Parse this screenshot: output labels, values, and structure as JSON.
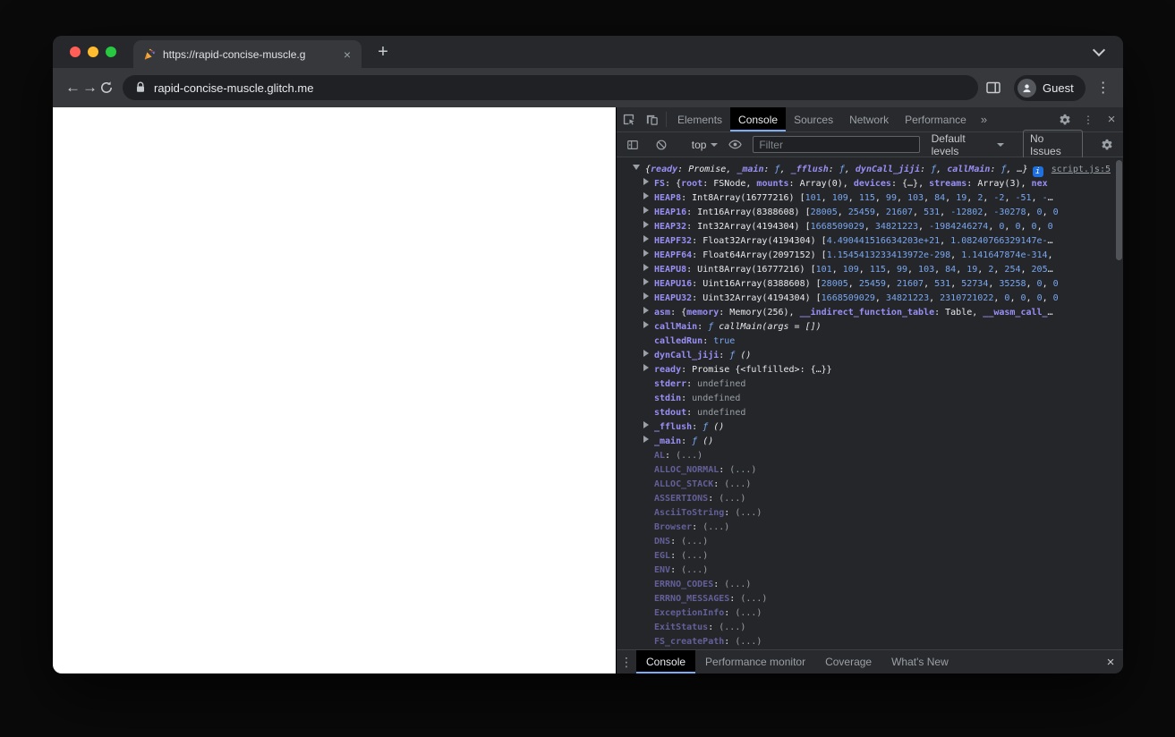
{
  "colors": {
    "accent": "#7cacf8",
    "key": "#9a8ff5",
    "number": "#79a7f2",
    "func": "#7cacf8",
    "plain": "#e8eaed",
    "muted": "#9aa0a6",
    "link": "#9aa0a6",
    "badge": "#1f6fde",
    "traffic_red": "#ff5f57",
    "traffic_yellow": "#febc2e",
    "traffic_green": "#28c840",
    "strip_bg": "#26282b",
    "chrome_bg": "#37383b",
    "omnibox_bg": "#202124",
    "bar_bg": "#292a2d",
    "devtools_bg": "#242629",
    "selected_tab_bg": "#000000",
    "page_bg": "#ffffff"
  },
  "icons": {
    "close": "×",
    "new_tab": "+",
    "menu": "⋮",
    "more_tabs": "»",
    "back": "←",
    "forward": "→",
    "info": "i"
  },
  "browser": {
    "tab_title": "https://rapid-concise-muscle.g",
    "url": "rapid-concise-muscle.glitch.me",
    "profile": "Guest"
  },
  "devtools": {
    "tabs": [
      "Elements",
      "Console",
      "Sources",
      "Network",
      "Performance"
    ],
    "toolbar": {
      "context": "top",
      "filter_placeholder": "Filter",
      "levels": "Default levels",
      "issues": "No Issues"
    },
    "drawer": {
      "tabs": [
        "Console",
        "Performance monitor",
        "Coverage",
        "What's New"
      ]
    },
    "console": {
      "lines": [
        {
          "t": "d",
          "ind": 0,
          "it": true,
          "badge": true,
          "link": "script.js:5",
          "toks": [
            [
              "p",
              "{"
            ],
            [
              "k",
              "ready"
            ],
            [
              "p",
              ": "
            ],
            [
              "p",
              "Promise"
            ],
            [
              "p",
              ", "
            ],
            [
              "k",
              "_main"
            ],
            [
              "p",
              ": "
            ],
            [
              "f",
              "ƒ"
            ],
            [
              "p",
              ", "
            ],
            [
              "k",
              "_fflush"
            ],
            [
              "p",
              ": "
            ],
            [
              "f",
              "ƒ"
            ],
            [
              "p",
              ", "
            ],
            [
              "k",
              "dynCall_jiji"
            ],
            [
              "p",
              ": "
            ],
            [
              "f",
              "ƒ"
            ],
            [
              "p",
              ", "
            ],
            [
              "k",
              "callMain"
            ],
            [
              "p",
              ": "
            ],
            [
              "f",
              "ƒ"
            ],
            [
              "p",
              ", …}"
            ]
          ]
        },
        {
          "t": "r",
          "toks": [
            [
              "k",
              "FS"
            ],
            [
              "p",
              ": {"
            ],
            [
              "k",
              "root"
            ],
            [
              "p",
              ": "
            ],
            [
              "p",
              "FSNode"
            ],
            [
              "p",
              ", "
            ],
            [
              "k",
              "mounts"
            ],
            [
              "p",
              ": "
            ],
            [
              "p",
              "Array(0)"
            ],
            [
              "p",
              ", "
            ],
            [
              "k",
              "devices"
            ],
            [
              "p",
              ": "
            ],
            [
              "p",
              "{…}"
            ],
            [
              "p",
              ", "
            ],
            [
              "k",
              "streams"
            ],
            [
              "p",
              ": "
            ],
            [
              "p",
              "Array(3)"
            ],
            [
              "p",
              ", "
            ],
            [
              "k",
              "nex"
            ]
          ]
        },
        {
          "t": "r",
          "toks": [
            [
              "k",
              "HEAP8"
            ],
            [
              "p",
              ": "
            ],
            [
              "p",
              "Int8Array(16777216) ["
            ],
            [
              "nl",
              "101, 109, 115, 99, 103, 84, 19, 2, -2, -51"
            ],
            [
              "p",
              ", "
            ],
            [
              "n",
              "-"
            ],
            [
              "p",
              "…"
            ]
          ]
        },
        {
          "t": "r",
          "toks": [
            [
              "k",
              "HEAP16"
            ],
            [
              "p",
              ": "
            ],
            [
              "p",
              "Int16Array(8388608) ["
            ],
            [
              "nl",
              "28005, 25459, 21607, 531, -12802, -30278, 0"
            ],
            [
              "p",
              ", "
            ],
            [
              "n",
              "0"
            ]
          ]
        },
        {
          "t": "r",
          "toks": [
            [
              "k",
              "HEAP32"
            ],
            [
              "p",
              ": "
            ],
            [
              "p",
              "Int32Array(4194304) ["
            ],
            [
              "nl",
              "1668509029, 34821223, -1984246274, 0, 0, 0"
            ],
            [
              "p",
              ", "
            ],
            [
              "n",
              "0"
            ]
          ]
        },
        {
          "t": "r",
          "toks": [
            [
              "k",
              "HEAPF32"
            ],
            [
              "p",
              ": "
            ],
            [
              "p",
              "Float32Array(4194304) ["
            ],
            [
              "n",
              "4.490441516634203e+21"
            ],
            [
              "p",
              ", "
            ],
            [
              "n",
              "1.08240766329147e-"
            ],
            [
              "p",
              "…"
            ]
          ]
        },
        {
          "t": "r",
          "toks": [
            [
              "k",
              "HEAPF64"
            ],
            [
              "p",
              ": "
            ],
            [
              "p",
              "Float64Array(2097152) ["
            ],
            [
              "n",
              "1.1545413233413972e-298"
            ],
            [
              "p",
              ", "
            ],
            [
              "n",
              "1.141647874e-314"
            ],
            [
              "p",
              ", "
            ]
          ]
        },
        {
          "t": "r",
          "toks": [
            [
              "k",
              "HEAPU8"
            ],
            [
              "p",
              ": "
            ],
            [
              "p",
              "Uint8Array(16777216) ["
            ],
            [
              "nl",
              "101, 109, 115, 99, 103, 84, 19, 2, 254, 205"
            ],
            [
              "p",
              "…"
            ]
          ]
        },
        {
          "t": "r",
          "toks": [
            [
              "k",
              "HEAPU16"
            ],
            [
              "p",
              ": "
            ],
            [
              "p",
              "Uint16Array(8388608) ["
            ],
            [
              "nl",
              "28005, 25459, 21607, 531, 52734, 35258, 0"
            ],
            [
              "p",
              ", "
            ],
            [
              "n",
              "0"
            ]
          ]
        },
        {
          "t": "r",
          "toks": [
            [
              "k",
              "HEAPU32"
            ],
            [
              "p",
              ": "
            ],
            [
              "p",
              "Uint32Array(4194304) ["
            ],
            [
              "nl",
              "1668509029, 34821223, 2310721022, 0, 0, 0"
            ],
            [
              "p",
              ", "
            ],
            [
              "n",
              "0"
            ]
          ]
        },
        {
          "t": "r",
          "toks": [
            [
              "k",
              "asm"
            ],
            [
              "p",
              ": {"
            ],
            [
              "k",
              "memory"
            ],
            [
              "p",
              ": "
            ],
            [
              "p",
              "Memory(256)"
            ],
            [
              "p",
              ", "
            ],
            [
              "k",
              "__indirect_function_table"
            ],
            [
              "p",
              ": "
            ],
            [
              "p",
              "Table"
            ],
            [
              "p",
              ", "
            ],
            [
              "k",
              "__wasm_call_"
            ],
            [
              "p",
              "…"
            ]
          ]
        },
        {
          "t": "r",
          "toks": [
            [
              "k",
              "callMain"
            ],
            [
              "p",
              ": "
            ],
            [
              "f",
              "ƒ "
            ],
            [
              "s",
              "callMain(args = [])"
            ]
          ]
        },
        {
          "toks": [
            [
              "k",
              "calledRun"
            ],
            [
              "p",
              ": "
            ],
            [
              "b",
              "true"
            ]
          ]
        },
        {
          "t": "r",
          "toks": [
            [
              "k",
              "dynCall_jiji"
            ],
            [
              "p",
              ": "
            ],
            [
              "f",
              "ƒ "
            ],
            [
              "s",
              "()"
            ]
          ]
        },
        {
          "t": "r",
          "toks": [
            [
              "k",
              "ready"
            ],
            [
              "p",
              ": "
            ],
            [
              "p",
              "Promise "
            ],
            [
              "p",
              "{<fulfilled>: {…}}"
            ]
          ]
        },
        {
          "toks": [
            [
              "k",
              "stderr"
            ],
            [
              "p",
              ": "
            ],
            [
              "u",
              "undefined"
            ]
          ]
        },
        {
          "toks": [
            [
              "k",
              "stdin"
            ],
            [
              "p",
              ": "
            ],
            [
              "u",
              "undefined"
            ]
          ]
        },
        {
          "toks": [
            [
              "k",
              "stdout"
            ],
            [
              "p",
              ": "
            ],
            [
              "u",
              "undefined"
            ]
          ]
        },
        {
          "t": "r",
          "toks": [
            [
              "k",
              "_fflush"
            ],
            [
              "p",
              ": "
            ],
            [
              "f",
              "ƒ "
            ],
            [
              "s",
              "()"
            ]
          ]
        },
        {
          "t": "r",
          "toks": [
            [
              "k",
              "_main"
            ],
            [
              "p",
              ": "
            ],
            [
              "f",
              "ƒ "
            ],
            [
              "s",
              "()"
            ]
          ]
        },
        {
          "toks": [
            [
              "kd",
              "AL"
            ],
            [
              "p",
              ": "
            ],
            [
              "d",
              "(...)"
            ]
          ]
        },
        {
          "toks": [
            [
              "kd",
              "ALLOC_NORMAL"
            ],
            [
              "p",
              ": "
            ],
            [
              "d",
              "(...)"
            ]
          ]
        },
        {
          "toks": [
            [
              "kd",
              "ALLOC_STACK"
            ],
            [
              "p",
              ": "
            ],
            [
              "d",
              "(...)"
            ]
          ]
        },
        {
          "toks": [
            [
              "kd",
              "ASSERTIONS"
            ],
            [
              "p",
              ": "
            ],
            [
              "d",
              "(...)"
            ]
          ]
        },
        {
          "toks": [
            [
              "kd",
              "AsciiToString"
            ],
            [
              "p",
              ": "
            ],
            [
              "d",
              "(...)"
            ]
          ]
        },
        {
          "toks": [
            [
              "kd",
              "Browser"
            ],
            [
              "p",
              ": "
            ],
            [
              "d",
              "(...)"
            ]
          ]
        },
        {
          "toks": [
            [
              "kd",
              "DNS"
            ],
            [
              "p",
              ": "
            ],
            [
              "d",
              "(...)"
            ]
          ]
        },
        {
          "toks": [
            [
              "kd",
              "EGL"
            ],
            [
              "p",
              ": "
            ],
            [
              "d",
              "(...)"
            ]
          ]
        },
        {
          "toks": [
            [
              "kd",
              "ENV"
            ],
            [
              "p",
              ": "
            ],
            [
              "d",
              "(...)"
            ]
          ]
        },
        {
          "toks": [
            [
              "kd",
              "ERRNO_CODES"
            ],
            [
              "p",
              ": "
            ],
            [
              "d",
              "(...)"
            ]
          ]
        },
        {
          "toks": [
            [
              "kd",
              "ERRNO_MESSAGES"
            ],
            [
              "p",
              ": "
            ],
            [
              "d",
              "(...)"
            ]
          ]
        },
        {
          "toks": [
            [
              "kd",
              "ExceptionInfo"
            ],
            [
              "p",
              ": "
            ],
            [
              "d",
              "(...)"
            ]
          ]
        },
        {
          "toks": [
            [
              "kd",
              "ExitStatus"
            ],
            [
              "p",
              ": "
            ],
            [
              "d",
              "(...)"
            ]
          ]
        },
        {
          "toks": [
            [
              "kd",
              "FS_createPath"
            ],
            [
              "p",
              ": "
            ],
            [
              "d",
              "(...)"
            ]
          ]
        }
      ]
    }
  }
}
